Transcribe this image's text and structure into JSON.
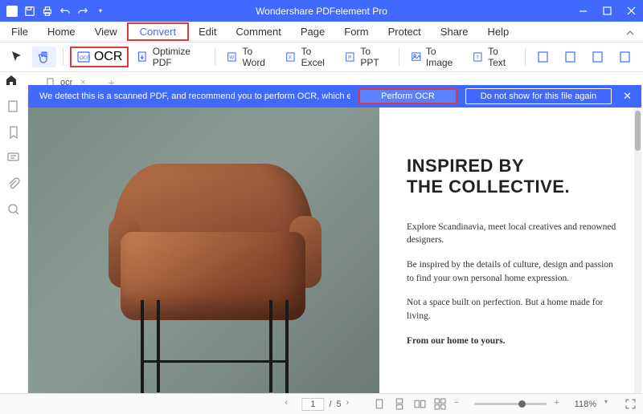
{
  "title": "Wondershare PDFelement Pro",
  "menu": [
    "File",
    "Home",
    "View",
    "Convert",
    "Edit",
    "Comment",
    "Page",
    "Form",
    "Protect",
    "Share",
    "Help"
  ],
  "menu_highlight_idx": 3,
  "toolbar": {
    "ocr": "OCR",
    "optimize": "Optimize PDF",
    "toword": "To Word",
    "toexcel": "To Excel",
    "toppt": "To PPT",
    "toimage": "To Image",
    "totext": "To Text"
  },
  "tab": {
    "name": "ocr"
  },
  "banner": {
    "msg": "We detect this is a scanned PDF, and recommend you to perform OCR, which enables you to ...",
    "perform": "Perform OCR",
    "hide": "Do not show for this file again"
  },
  "doc": {
    "h1a": "INSPIRED BY",
    "h1b": "THE COLLECTIVE.",
    "p1": "Explore Scandinavia, meet local creatives and renowned designers.",
    "p2": "Be inspired by the details of culture, design and passion to find your own personal home expression.",
    "p3": "Not a space built on perfection. But a home made for living.",
    "p4": "From our home to yours."
  },
  "status": {
    "page_cur": "1",
    "page_sep": "/",
    "page_total": "5",
    "zoom": "118%"
  }
}
